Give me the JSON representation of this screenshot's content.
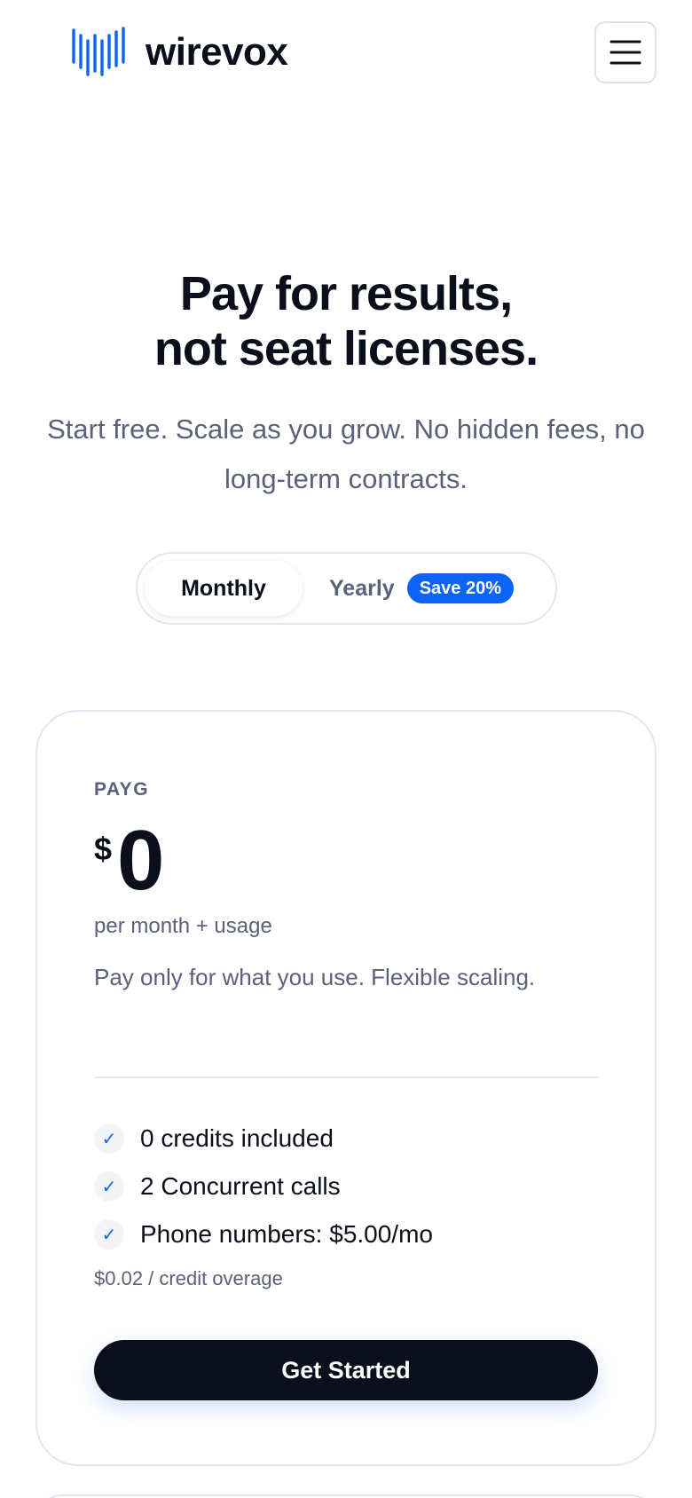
{
  "header": {
    "brand": "wirevox",
    "logo_icon": "waveform-logo-icon",
    "menu_icon": "hamburger-menu-icon",
    "accent_color": "#0d63f3"
  },
  "hero": {
    "title_line1": "Pay for results,",
    "title_line2": "not seat licenses.",
    "subtitle": "Start free. Scale as you grow. No hidden fees, no long-term contracts."
  },
  "billing_toggle": {
    "monthly_label": "Monthly",
    "yearly_label": "Yearly",
    "save_badge": "Save 20%",
    "selected": "Monthly"
  },
  "plan": {
    "name": "PAYG",
    "currency": "$",
    "price": "0",
    "period": "per month + usage",
    "description": "Pay only for what you use. Flexible scaling.",
    "features": [
      "0 credits included",
      "2 Concurrent calls",
      "Phone numbers: $5.00/mo"
    ],
    "check_icon": "checkmark-icon",
    "overage": "$0.02 / credit overage",
    "cta_label": "Get Started"
  }
}
